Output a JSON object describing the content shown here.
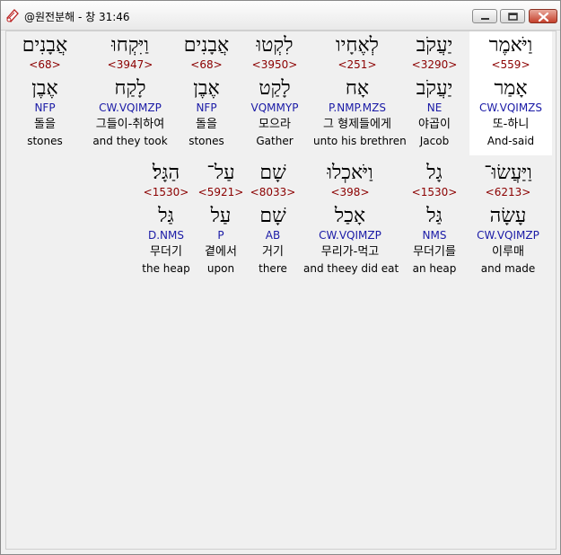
{
  "window": {
    "title": "@원전분해 - 창 31:46"
  },
  "icons": {
    "app": "scroll-book-icon",
    "minimize": "minimize-icon",
    "maximize": "maximize-icon",
    "close": "close-icon"
  },
  "rows": [
    {
      "words": [
        {
          "hebrew": "וַיֹּאמֶר",
          "strong": "<559>",
          "lemma": "אָמַר",
          "morph": "CW.VQIMZS",
          "korean": "또-하니",
          "english": "And-said",
          "selected": true
        },
        {
          "hebrew": "יַעֲקֹב",
          "strong": "<3290>",
          "lemma": "יַעֲקֹב",
          "morph": "NE",
          "korean": "야곱이",
          "english": "Jacob"
        },
        {
          "hebrew": "לְאֶחָיו",
          "strong": "<251>",
          "lemma": "אָח",
          "morph": "P.NMP.MZS",
          "korean": "그 형제들에게",
          "english": "unto his brethren"
        },
        {
          "hebrew": "לִקְטוּ",
          "strong": "<3950>",
          "lemma": "לָקַט",
          "morph": "VQMMYP",
          "korean": "모으라",
          "english": "Gather"
        },
        {
          "hebrew": "אֲבָנִים",
          "strong": "<68>",
          "lemma": "אֶבֶן",
          "morph": "NFP",
          "korean": "돌을",
          "english": "stones"
        },
        {
          "hebrew": "וַיִּקְחוּ",
          "strong": "<3947>",
          "lemma": "לָקַח",
          "morph": "CW.VQIMZP",
          "korean": "그들이-취하여",
          "english": "and they took"
        },
        {
          "hebrew": "אֲבָנִים",
          "strong": "<68>",
          "lemma": "אֶבֶן",
          "morph": "NFP",
          "korean": "돌을",
          "english": "stones"
        }
      ]
    },
    {
      "words": [
        {
          "hebrew": "וַיַּעֲשׂוּ־",
          "strong": "<6213>",
          "lemma": "עָשָׂה",
          "morph": "CW.VQIMZP",
          "korean": "이루매",
          "english": "and made"
        },
        {
          "hebrew": "גָל",
          "strong": "<1530>",
          "lemma": "גַּל",
          "morph": "NMS",
          "korean": "무더기를",
          "english": "an heap"
        },
        {
          "hebrew": "וַיֹּאכְלוּ",
          "strong": "<398>",
          "lemma": "אָכַל",
          "morph": "CW.VQIMZP",
          "korean": "무리가-먹고",
          "english": "and theey did eat"
        },
        {
          "hebrew": "שָׁם",
          "strong": "<8033>",
          "lemma": "שָׁם",
          "morph": "AB",
          "korean": "거기",
          "english": "there"
        },
        {
          "hebrew": "עַל־",
          "strong": "<5921>",
          "lemma": "עַל",
          "morph": "P",
          "korean": "곁에서",
          "english": "upon"
        },
        {
          "hebrew": "הַגָּל׃",
          "strong": "<1530>",
          "lemma": "גַּל",
          "morph": "D.NMS",
          "korean": "무더기",
          "english": "the heap"
        }
      ]
    }
  ]
}
